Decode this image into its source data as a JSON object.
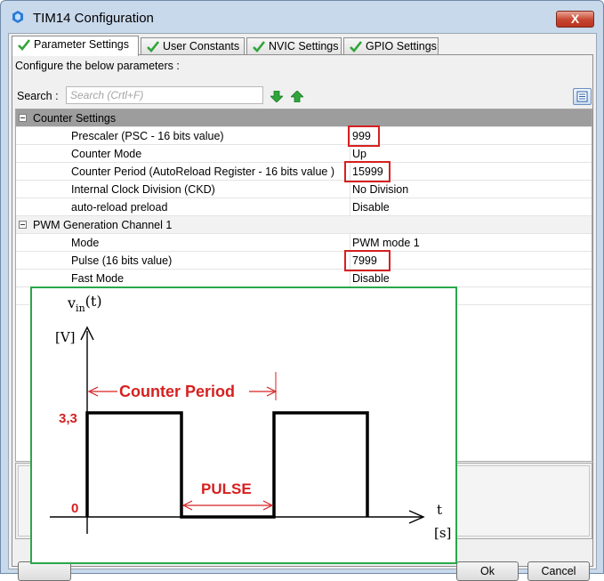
{
  "window": {
    "title": "TIM14 Configuration",
    "close_label": "X"
  },
  "tabs": [
    {
      "label": "Parameter Settings",
      "active": true
    },
    {
      "label": "User Constants",
      "active": false
    },
    {
      "label": "NVIC Settings",
      "active": false
    },
    {
      "label": "GPIO Settings",
      "active": false
    }
  ],
  "panel": {
    "configure_label": "Configure the below parameters :",
    "search_label": "Search :",
    "search_placeholder": "Search (Crtl+F)"
  },
  "groups": [
    {
      "label": "Counter Settings",
      "params": [
        {
          "name": "Prescaler (PSC - 16 bits value)",
          "value": "999",
          "highlighted": true
        },
        {
          "name": "Counter Mode",
          "value": "Up",
          "highlighted": false
        },
        {
          "name": "Counter Period (AutoReload Register - 16 bits value )",
          "value": "15999",
          "highlighted": true
        },
        {
          "name": "Internal Clock Division (CKD)",
          "value": "No Division",
          "highlighted": false
        },
        {
          "name": "auto-reload preload",
          "value": "Disable",
          "highlighted": false
        }
      ]
    },
    {
      "label": "PWM Generation Channel 1",
      "params": [
        {
          "name": "Mode",
          "value": "PWM mode 1",
          "highlighted": false
        },
        {
          "name": "Pulse (16 bits value)",
          "value": "7999",
          "highlighted": true
        },
        {
          "name": "Fast Mode",
          "value": "Disable",
          "highlighted": false
        }
      ]
    }
  ],
  "buttons": {
    "ok_label": "Ok",
    "cancel_label": "Cancel"
  },
  "diagram": {
    "y_axis_label": "vin(t)",
    "y_axis_symbol": "v",
    "y_axis_subscript": "in",
    "y_axis_arg": "(t)",
    "y_unit": "[V]",
    "x_axis_label": "t",
    "x_unit": "[s]",
    "level_high": "3,3",
    "level_low": "0",
    "period_label": "Counter Period",
    "pulse_label": "PULSE",
    "highlight_color": "#d62020",
    "frame_color": "#29a84a"
  },
  "colors": {
    "accent": "#2e7bd6",
    "check_green": "#2fa53a",
    "highlight_red": "#d62020"
  }
}
